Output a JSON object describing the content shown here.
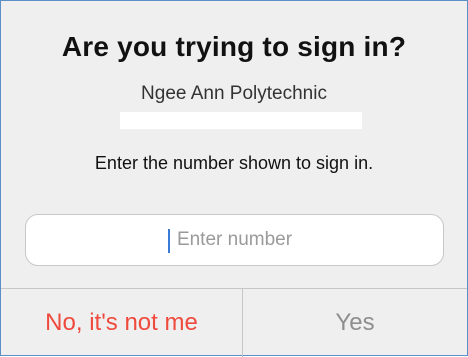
{
  "dialog": {
    "title": "Are you trying to sign in?",
    "organization": "Ngee Ann Polytechnic",
    "instruction": "Enter the number shown to sign in.",
    "number_field": {
      "placeholder": "Enter number",
      "value": ""
    },
    "actions": {
      "deny_label": "No, it's not me",
      "approve_label": "Yes"
    }
  },
  "colors": {
    "background": "#efefef",
    "deny_text": "#ef4a3e",
    "approve_text_disabled": "#8e8e8e",
    "caret": "#3a7bd5"
  }
}
